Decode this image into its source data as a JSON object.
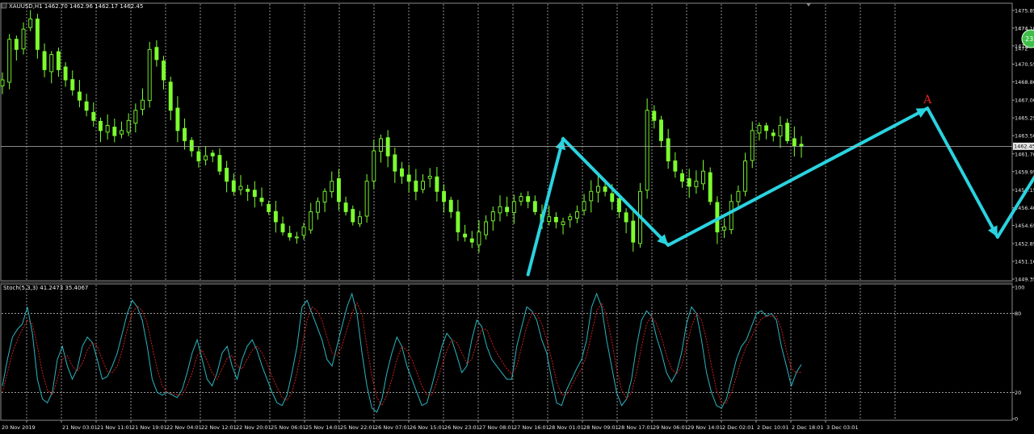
{
  "chart_data": [
    {
      "type": "candlestick",
      "title": "XAUUSD,H1 1462.70 1462.96 1462.17 1462.45",
      "current_price": 1462.45,
      "ylim": [
        1449.35,
        1476.4
      ],
      "price_ticks": [
        "1475.85",
        "1474.10",
        "1472.35",
        "1470.55",
        "1468.80",
        "1467.00",
        "1465.25",
        "1463.50",
        "1461.70",
        "1459.95",
        "1458.15",
        "1456.40",
        "1454.65",
        "1452.85",
        "1451.10",
        "1449.35"
      ],
      "price_ticks_clipped": [
        "1474",
        "1472"
      ],
      "time_labels": [
        "20 Nov 2019",
        "21 Nov 03:01",
        "21 Nov 11:01",
        "21 Nov 19:01",
        "22 Nov 04:01",
        "22 Nov 12:01",
        "22 Nov 20:01",
        "25 Nov 06:01",
        "25 Nov 14:01",
        "25 Nov 22:01",
        "26 Nov 07:01",
        "26 Nov 15:01",
        "26 Nov 23:01",
        "27 Nov 08:01",
        "27 Nov 16:01",
        "28 Nov 01:01",
        "28 Nov 09:01",
        "28 Nov 17:01",
        "29 Nov 06:01",
        "29 Nov 14:01",
        "2 Dec 02:01",
        "2 Dec 10:01",
        "2 Dec 18:01",
        "3 Dec 03:01"
      ],
      "close_path": [
        1469,
        1473,
        1472,
        1474,
        1475,
        1472,
        1470,
        1471.5,
        1470,
        1469,
        1468,
        1467,
        1466,
        1465,
        1464,
        1464.5,
        1463.5,
        1464,
        1465,
        1466,
        1467,
        1472,
        1471,
        1469,
        1466,
        1464,
        1463,
        1462,
        1461,
        1461.5,
        1461.5,
        1460,
        1459,
        1458,
        1458.5,
        1458,
        1457.5,
        1457,
        1456,
        1455,
        1454,
        1453.5,
        1453.5,
        1454.5,
        1456,
        1457,
        1458,
        1459,
        1457,
        1456,
        1455,
        1455.5,
        1459,
        1462,
        1463.2,
        1461.5,
        1460,
        1459.5,
        1459,
        1458,
        1459,
        1459.5,
        1458,
        1457,
        1456,
        1454,
        1453.5,
        1453,
        1454,
        1455,
        1456,
        1456.5,
        1456,
        1457,
        1457.5,
        1457,
        1456,
        1455,
        1455.5,
        1455,
        1455,
        1455.5,
        1456,
        1457,
        1458,
        1458.5,
        1458,
        1457,
        1456,
        1455,
        1453,
        1458,
        1466,
        1465,
        1463,
        1461,
        1460,
        1459,
        1458.5,
        1459,
        1460,
        1457,
        1454,
        1454.5,
        1457,
        1458,
        1461,
        1464,
        1464.5,
        1464,
        1463.5,
        1464.5,
        1463,
        1462.5,
        1462.45
      ],
      "annotation_marker": "A",
      "trend_arrows_price_points": [
        {
          "x_index": 75,
          "price": 1449.8
        },
        {
          "x_index": 80,
          "price": 1463.2
        },
        {
          "x_index": 95,
          "price": 1452.7
        },
        {
          "x_index": 132,
          "price": 1466.2
        },
        {
          "x_index": 142,
          "price": 1453.5
        },
        {
          "x_index": 152,
          "price": 1464.7
        },
        {
          "x_index": 156,
          "price": 1462.6
        },
        {
          "x_index": 166,
          "price": 1455.5
        }
      ],
      "colors": {
        "background": "#000000",
        "bull": "#7cff2f",
        "bear": "#7cff2f",
        "grid": "#ffffff",
        "arrow": "#2ad3e0",
        "marker": "#e0211e"
      }
    },
    {
      "type": "line",
      "title": "Stoch(5,3,3) 41.2473 35.4067",
      "ylim": [
        0,
        100
      ],
      "y_ticks": [
        "100",
        "80",
        "20",
        "0"
      ],
      "levels": [
        80,
        20
      ],
      "series": [
        {
          "name": "main",
          "color": "#2bb5c0",
          "values": [
            25,
            45,
            62,
            68,
            72,
            85,
            65,
            30,
            15,
            12,
            20,
            45,
            55,
            40,
            30,
            38,
            55,
            62,
            58,
            45,
            30,
            32,
            40,
            50,
            65,
            80,
            90,
            85,
            75,
            55,
            30,
            20,
            18,
            20,
            18,
            16,
            22,
            35,
            50,
            60,
            45,
            30,
            25,
            35,
            50,
            55,
            40,
            30,
            45,
            55,
            60,
            52,
            40,
            30,
            20,
            12,
            10,
            18,
            35,
            55,
            85,
            90,
            80,
            70,
            60,
            45,
            40,
            55,
            70,
            85,
            95,
            80,
            50,
            25,
            8,
            5,
            15,
            35,
            50,
            62,
            55,
            40,
            30,
            20,
            10,
            12,
            25,
            40,
            55,
            65,
            60,
            48,
            35,
            40,
            60,
            75,
            70,
            55,
            45,
            40,
            35,
            30,
            30,
            55,
            70,
            85,
            82,
            75,
            60,
            50,
            30,
            12,
            10,
            22,
            30,
            38,
            45,
            60,
            85,
            95,
            85,
            60,
            40,
            20,
            10,
            15,
            30,
            55,
            75,
            82,
            78,
            62,
            50,
            35,
            28,
            35,
            50,
            72,
            85,
            80,
            60,
            35,
            20,
            10,
            8,
            15,
            30,
            45,
            55,
            60,
            70,
            80,
            82,
            78,
            80,
            75,
            55,
            40,
            25,
            35,
            41.2
          ],
          "marker_color": "#2bb5c0"
        },
        {
          "name": "signal",
          "color": "#e0211e",
          "values": [
            20,
            35,
            50,
            60,
            68,
            75,
            72,
            55,
            35,
            22,
            18,
            30,
            45,
            48,
            40,
            36,
            42,
            52,
            58,
            55,
            45,
            36,
            35,
            40,
            52,
            68,
            80,
            86,
            82,
            72,
            55,
            38,
            25,
            20,
            19,
            18,
            18,
            25,
            35,
            48,
            52,
            44,
            35,
            30,
            38,
            46,
            48,
            40,
            38,
            45,
            52,
            55,
            50,
            42,
            32,
            24,
            16,
            14,
            20,
            35,
            55,
            75,
            85,
            82,
            75,
            62,
            50,
            48,
            55,
            68,
            80,
            88,
            80,
            55,
            32,
            16,
            10,
            18,
            30,
            45,
            55,
            52,
            45,
            35,
            25,
            18,
            18,
            28,
            40,
            52,
            60,
            58,
            50,
            42,
            45,
            58,
            68,
            68,
            58,
            50,
            44,
            38,
            34,
            40,
            55,
            70,
            80,
            80,
            72,
            60,
            45,
            28,
            18,
            18,
            25,
            32,
            38,
            48,
            65,
            82,
            88,
            78,
            60,
            38,
            22,
            15,
            20,
            35,
            55,
            72,
            78,
            72,
            62,
            48,
            38,
            34,
            40,
            55,
            70,
            80,
            75,
            60,
            40,
            22,
            12,
            12,
            20,
            32,
            45,
            55,
            62,
            70,
            76,
            78,
            78,
            78,
            68,
            52,
            38,
            35,
            35.4
          ],
          "marker_color": "#e0211e"
        }
      ]
    }
  ],
  "badge": {
    "text": "23"
  }
}
